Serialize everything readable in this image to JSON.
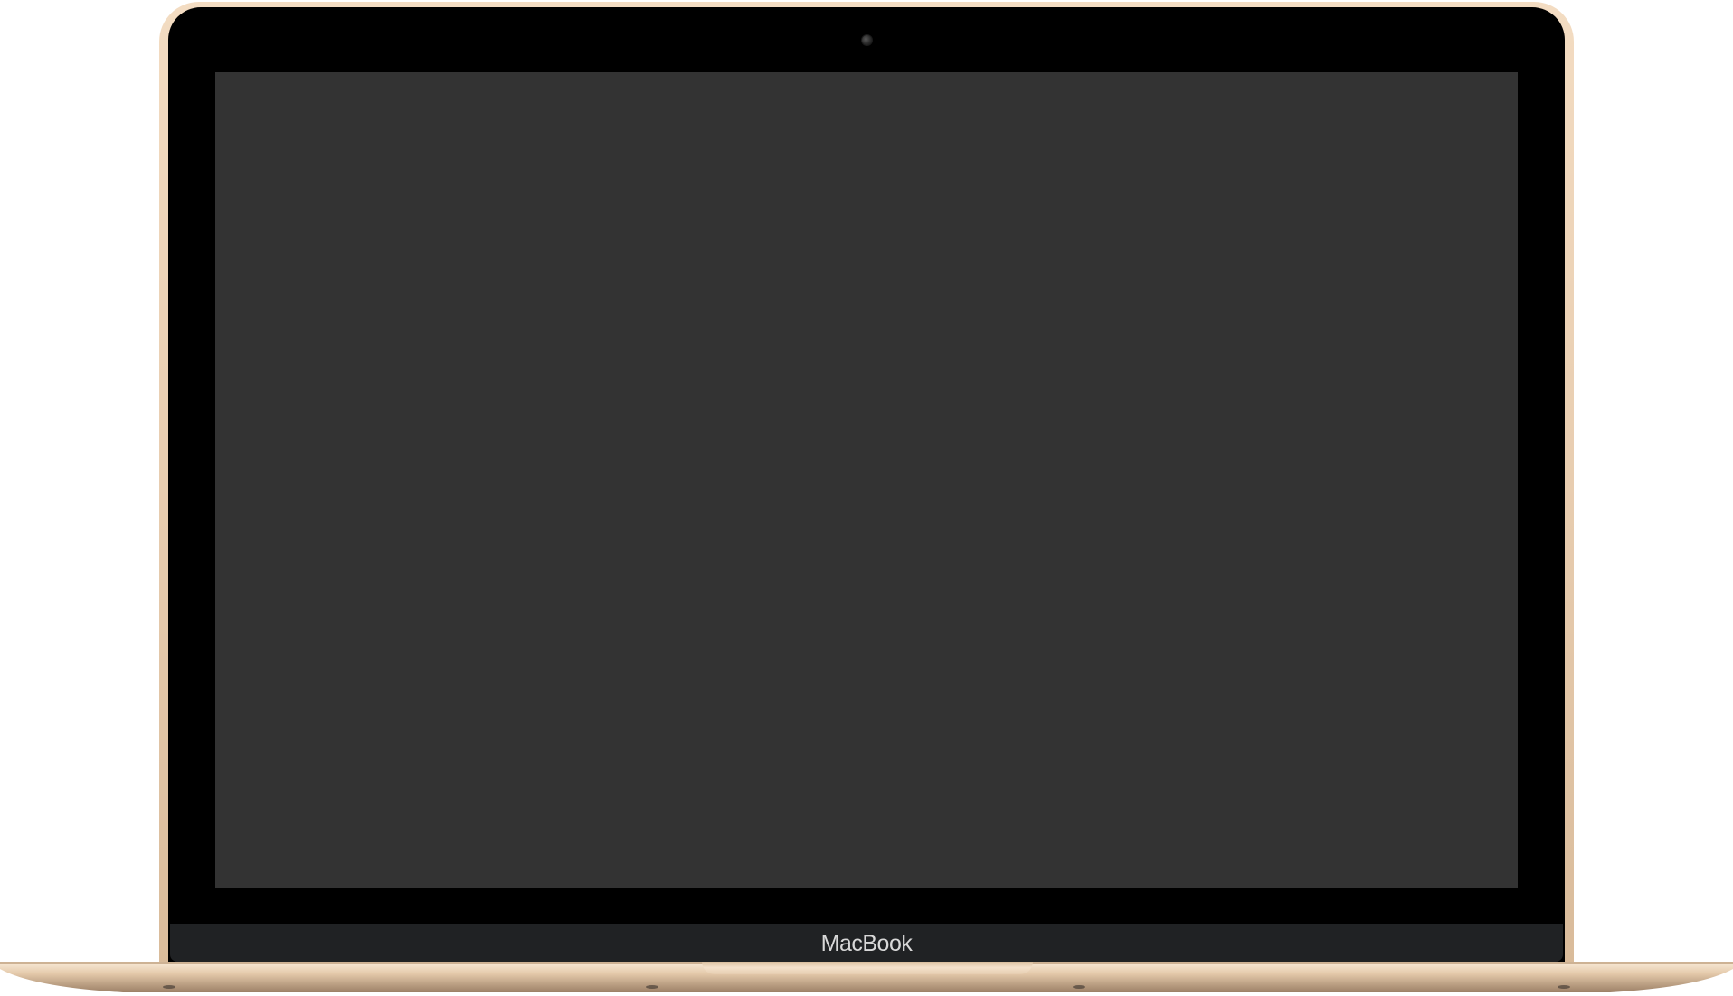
{
  "device": {
    "brand_label": "MacBook",
    "colors": {
      "gold": "#e8cdb0",
      "bezel": "#000000",
      "screen": "#333333",
      "chin": "#202224",
      "brand_text": "#d8d8d8"
    },
    "icons": [
      "camera-icon"
    ]
  }
}
